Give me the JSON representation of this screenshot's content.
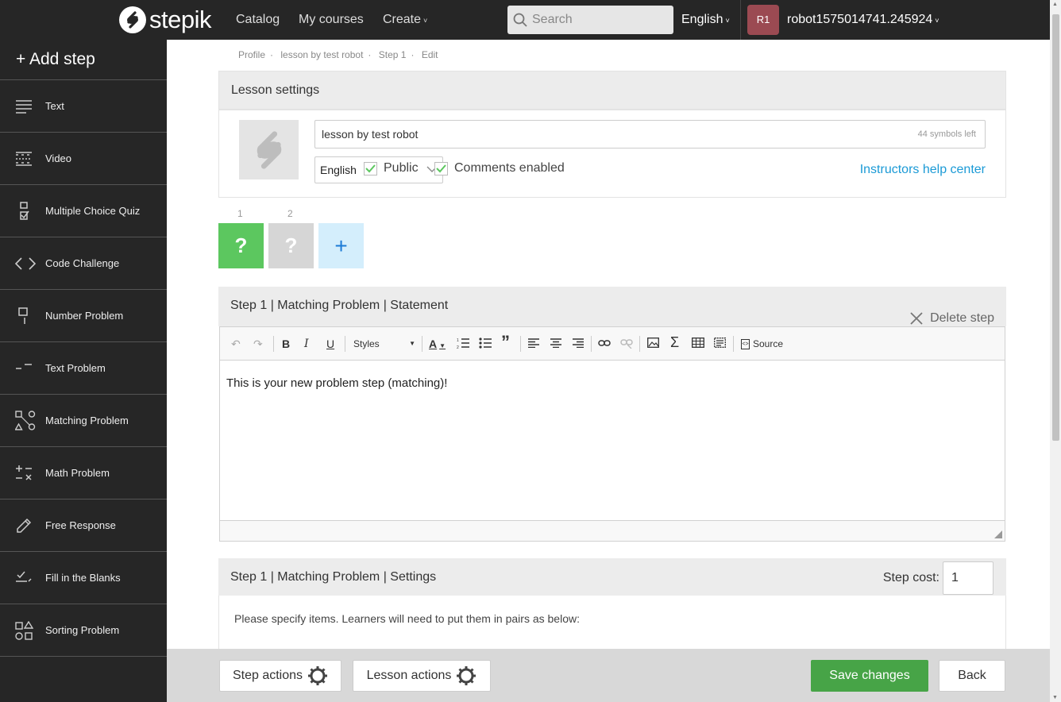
{
  "header": {
    "logo_text": "stepik",
    "nav": [
      "Catalog",
      "My courses",
      "Create"
    ],
    "search_placeholder": "Search",
    "language": "English",
    "avatar_initials": "R1",
    "username": "robot1575014741.245924"
  },
  "sidebar": {
    "add_step": "+ Add step",
    "items": [
      {
        "label": "Text",
        "icon": "text-lines-icon"
      },
      {
        "label": "Video",
        "icon": "video-icon"
      },
      {
        "label": "Multiple Choice Quiz",
        "icon": "quiz-icon"
      },
      {
        "label": "Code Challenge",
        "icon": "code-icon"
      },
      {
        "label": "Number Problem",
        "icon": "number-icon"
      },
      {
        "label": "Text Problem",
        "icon": "text-problem-icon"
      },
      {
        "label": "Matching Problem",
        "icon": "matching-icon"
      },
      {
        "label": "Math Problem",
        "icon": "math-icon"
      },
      {
        "label": "Free Response",
        "icon": "pencil-icon"
      },
      {
        "label": "Fill in the Blanks",
        "icon": "fill-blanks-icon"
      },
      {
        "label": "Sorting Problem",
        "icon": "sorting-icon"
      }
    ]
  },
  "breadcrumb": [
    "Profile",
    "lesson by test robot",
    "Step 1",
    "Edit"
  ],
  "lesson_settings": {
    "title": "Lesson settings",
    "lesson_title": "lesson by test robot",
    "symbols_left": "44 symbols left",
    "language": "English",
    "public_label": "Public",
    "comments_label": "Comments enabled",
    "help_link": "Instructors help center"
  },
  "steps": {
    "numbers": [
      "1",
      "2"
    ],
    "glyph": "?",
    "add": "+"
  },
  "statement": {
    "header": "Step 1 | Matching Problem | Statement",
    "delete": "Delete step",
    "styles_label": "Styles",
    "source_label": "Source",
    "text": "This is your new problem step (matching)!"
  },
  "settings": {
    "header": "Step 1 | Matching Problem | Settings",
    "cost_label": "Step cost:",
    "cost_value": "1",
    "instructions": "Please specify items. Learners will need to put them in pairs as below:"
  },
  "footer": {
    "step_actions": "Step actions",
    "lesson_actions": "Lesson actions",
    "save": "Save changes",
    "back": "Back"
  },
  "colors": {
    "accent_green": "#5cc75f",
    "save_green": "#47a447",
    "link_blue": "#1b9ad6",
    "avatar": "#9b4a52"
  }
}
